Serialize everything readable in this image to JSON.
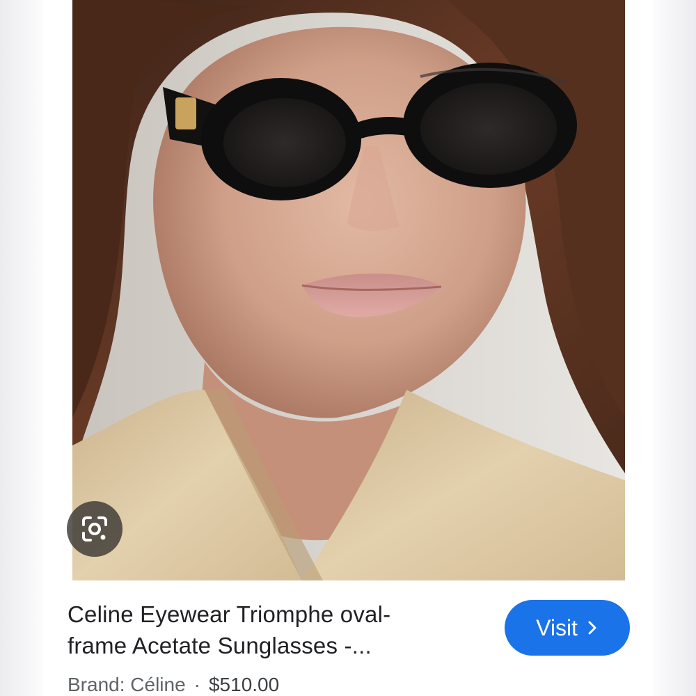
{
  "result": {
    "title_line1": "Celine Eyewear Triomphe oval-",
    "title_line2": "frame Acetate Sunglasses -...",
    "brand": "Brand: Céline",
    "separator": "·",
    "price": "$510.00",
    "visit_label": "Visit"
  },
  "icons": {
    "lens": "google-lens-icon",
    "chevron": "chevron-right-icon"
  },
  "colors": {
    "accent": "#1a73e8",
    "title_text": "#202124",
    "meta_text": "#5f6368"
  }
}
